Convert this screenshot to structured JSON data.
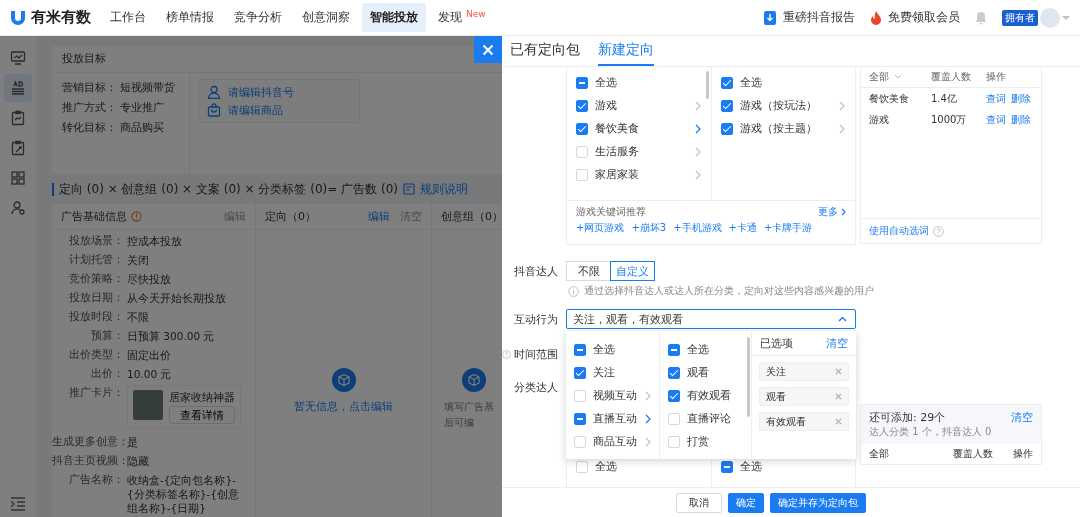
{
  "topbar": {
    "logo": "有米有数",
    "nav": [
      {
        "label": "工作台",
        "selected": false
      },
      {
        "label": "榜单情报",
        "selected": false
      },
      {
        "label": "竞争分析",
        "selected": false
      },
      {
        "label": "创意洞察",
        "selected": false
      },
      {
        "label": "智能投放",
        "selected": true
      },
      {
        "label": "发现",
        "selected": false,
        "badge": "New"
      }
    ],
    "actions": [
      "重磅抖音报告",
      "免费领取会员"
    ],
    "role": "拥有者"
  },
  "sidebar": {
    "items": [
      {
        "selected": false
      },
      {
        "selected": true
      },
      {
        "selected": false
      },
      {
        "selected": false
      },
      {
        "selected": false
      },
      {
        "selected": false
      }
    ]
  },
  "goal_card": {
    "title": "投放目标",
    "fields": [
      {
        "label": "营销目标：",
        "value": "短视频带货"
      },
      {
        "label": "推广方式：",
        "value": "专业推广"
      },
      {
        "label": "转化目标：",
        "value": "商品购买"
      }
    ],
    "links": [
      "请编辑抖音号",
      "请编辑商品"
    ]
  },
  "formula": {
    "text": "定向 (0) × 创意组 (0) × 文案 (0) × 分类标签 (0)= 广告数 (0)",
    "link": "规则说明"
  },
  "columns": [
    {
      "title": "广告基础信息",
      "warn": true,
      "actions": [
        {
          "label": "编辑",
          "disabled": true
        }
      ],
      "fields": [
        {
          "kind": "text",
          "label": "投放场景：",
          "value": "控成本投放"
        },
        {
          "kind": "text",
          "label": "计划托管：",
          "value": "关闭"
        },
        {
          "kind": "text",
          "label": "竞价策略：",
          "value": "尽快投放"
        },
        {
          "kind": "text",
          "label": "投放日期：",
          "value": "从今天开始长期投放"
        },
        {
          "kind": "text",
          "label": "投放时段：",
          "value": "不限"
        },
        {
          "kind": "text",
          "label": "预算：",
          "value": "日预算 300.00 元"
        },
        {
          "kind": "text",
          "label": "出价类型：",
          "value": "固定出价"
        },
        {
          "kind": "text",
          "label": "出价：",
          "value": "10.00 元"
        },
        {
          "kind": "card",
          "label": "推广卡片：",
          "value": "居家收纳神器",
          "button": "查看详情"
        },
        {
          "kind": "text",
          "label": "生成更多创意：",
          "value": "是"
        },
        {
          "kind": "text",
          "label": "抖音主页视频：",
          "value": "隐藏"
        },
        {
          "kind": "text",
          "label": "广告名称：",
          "value": "收纳盒-{定向包名称}-{分类标签名称}-{创意组名称}-{日期}"
        }
      ]
    },
    {
      "title": "定向（0）",
      "actions": [
        {
          "label": "编辑",
          "disabled": false
        },
        {
          "label": "清空",
          "disabled": true
        }
      ],
      "empty": {
        "kind": "link",
        "lines": [
          "暂无信息，点击编辑"
        ]
      }
    },
    {
      "title": "创意组（0）",
      "empty": {
        "kind": "text",
        "lines": [
          "填写广告基",
          "后可编"
        ]
      }
    }
  ],
  "drawer": {
    "tabs": [
      {
        "label": "已有定向包",
        "selected": false
      },
      {
        "label": "新建定向",
        "selected": true
      }
    ],
    "interest": {
      "columns": [
        {
          "items": [
            {
              "label": "全选",
              "indeterminate": true,
              "submenu": false
            },
            {
              "label": "游戏",
              "checked": true,
              "indeterminate": false,
              "submenu": true,
              "expanded": false
            },
            {
              "label": "餐饮美食",
              "checked": true,
              "indeterminate": false,
              "submenu": true,
              "expanded": true
            },
            {
              "label": "生活服务",
              "checked": false,
              "indeterminate": false,
              "submenu": true,
              "expanded": false
            },
            {
              "label": "家居家装",
              "checked": false,
              "indeterminate": false,
              "submenu": true,
              "expanded": false
            }
          ]
        },
        {
          "items": [
            {
              "label": "全选",
              "checked": true,
              "indeterminate": false,
              "submenu": false
            },
            {
              "label": "游戏（按玩法）",
              "checked": true,
              "indeterminate": false,
              "submenu": true,
              "expanded": false
            },
            {
              "label": "游戏（按主题）",
              "checked": true,
              "indeterminate": false,
              "submenu": true,
              "expanded": false
            }
          ]
        }
      ],
      "keyword_title": "游戏关键词推荐",
      "more": "更多",
      "keywords": [
        "+网页游戏",
        "+崩坏3",
        "+手机游戏",
        "+卡通",
        "+卡牌手游"
      ]
    },
    "word_table": {
      "columns": [
        "全部",
        "覆盖人数",
        "操作"
      ],
      "rows": [
        {
          "name": "餐饮美食",
          "coverage": "1.4亿",
          "actions": [
            "查词",
            "删除"
          ]
        },
        {
          "name": "游戏",
          "coverage": "1000万",
          "actions": [
            "查词",
            "删除"
          ]
        }
      ],
      "auto": "使用自动选词"
    },
    "creator": {
      "label": "抖音达人",
      "options": [
        {
          "label": "不限",
          "selected": false
        },
        {
          "label": "自定义",
          "selected": true
        }
      ],
      "hint": "通过选择抖音达人或达人所在分类，定向对这些内容感兴趣的用户"
    },
    "interaction": {
      "label": "互动行为",
      "value": "关注，观看，有效观看",
      "expanded": true,
      "menu": {
        "columns": [
          {
            "items": [
              {
                "label": "全选",
                "indeterminate": true,
                "submenu": false
              },
              {
                "label": "关注",
                "checked": true,
                "indeterminate": false,
                "submenu": false
              },
              {
                "label": "视频互动",
                "checked": false,
                "indeterminate": false,
                "submenu": true,
                "expanded": false
              },
              {
                "label": "直播互动",
                "indeterminate": true,
                "submenu": true,
                "expanded": true
              },
              {
                "label": "商品互动",
                "checked": false,
                "indeterminate": false,
                "submenu": true,
                "expanded": false
              }
            ]
          },
          {
            "items": [
              {
                "label": "全选",
                "indeterminate": true,
                "submenu": false
              },
              {
                "label": "观看",
                "checked": true,
                "indeterminate": false,
                "submenu": false
              },
              {
                "label": "有效观看",
                "checked": true,
                "indeterminate": false,
                "submenu": false
              },
              {
                "label": "直播评论",
                "checked": false,
                "indeterminate": false,
                "submenu": false
              },
              {
                "label": "打赏",
                "checked": false,
                "indeterminate": false,
                "submenu": false
              }
            ]
          }
        ],
        "selected_title": "已选项",
        "clear": "清空",
        "tags": [
          "关注",
          "观看",
          "有效观看"
        ]
      }
    },
    "time_range": {
      "label": "时间范围"
    },
    "category": {
      "label": "分类达人",
      "columns": [
        {
          "items": [
            {
              "label": "全选",
              "checked": false,
              "indeterminate": false,
              "submenu": false
            }
          ]
        },
        {
          "items": [
            {
              "label": "全选",
              "indeterminate": true,
              "submenu": false
            }
          ]
        }
      ],
      "remaining": "还可添加: 29个",
      "clear": "清空",
      "detail": "达人分类 1 个，抖音达人 0",
      "table_columns": [
        "全部",
        "覆盖人数",
        "操作"
      ]
    },
    "buttons": [
      {
        "label": "取消",
        "kind": "default"
      },
      {
        "label": "确定",
        "kind": "primary"
      },
      {
        "label": "确定并存为定向包",
        "kind": "primary"
      }
    ]
  }
}
